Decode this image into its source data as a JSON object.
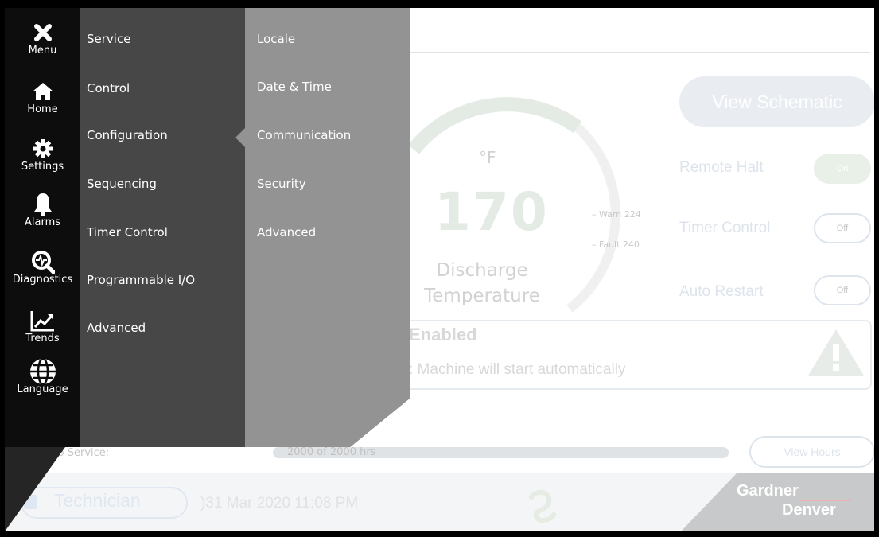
{
  "sidebar": {
    "items": [
      {
        "label": "Menu",
        "icon": "close-icon"
      },
      {
        "label": "Home",
        "icon": "home-icon"
      },
      {
        "label": "Settings",
        "icon": "gear-icon"
      },
      {
        "label": "Alarms",
        "icon": "bell-icon"
      },
      {
        "label": "Diagnostics",
        "icon": "diagnostics-magnifier-icon"
      },
      {
        "label": "Trends",
        "icon": "trend-chart-icon"
      },
      {
        "label": "Language",
        "icon": "globe-icon"
      }
    ]
  },
  "settings_menu": {
    "items": [
      "Service",
      "Control",
      "Configuration",
      "Sequencing",
      "Timer Control",
      "Programmable I/O",
      "Advanced"
    ],
    "selected": "Configuration"
  },
  "configuration_menu": {
    "items": [
      "Locale",
      "Date & Time",
      "Communication",
      "Security",
      "Advanced"
    ]
  },
  "dashboard": {
    "gauge": {
      "unit": "°F",
      "value": "170",
      "label_line1": "Discharge",
      "label_line2": "Temperature",
      "warn": "– Warn 224",
      "fault": "– Fault 240"
    },
    "view_schematic": "View Schematic",
    "toggles": [
      {
        "label": "Remote Halt",
        "state": "On"
      },
      {
        "label": "Timer Control",
        "state": "Off"
      },
      {
        "label": "Auto Restart",
        "state": "Off"
      }
    ],
    "status": {
      "title": "Enabled",
      "message": ": Machine will start automatically"
    },
    "service": {
      "label": "eft to Service:",
      "value_text": "2000 of 2000 hrs",
      "fraction": 1.0,
      "button": "View Hours"
    }
  },
  "footer": {
    "user": "Technician",
    "datetime": ")31 Mar 2020 11:08 PM",
    "brand_line1": "Gardner",
    "brand_line2": "Denver"
  },
  "colors": {
    "sidebar": "#0d0d0d",
    "settings_column": "#474747",
    "submenu_column": "#939393",
    "gauge_arc": "#e4ebe4"
  }
}
